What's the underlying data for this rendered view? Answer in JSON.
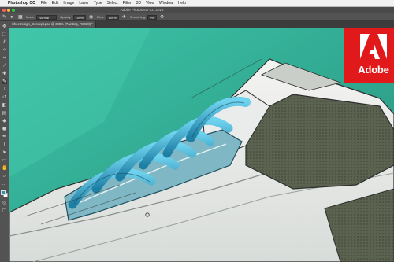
{
  "menubar": {
    "app_name": "Photoshop CC",
    "items": [
      "File",
      "Edit",
      "Image",
      "Layer",
      "Type",
      "Select",
      "Filter",
      "3D",
      "View",
      "Window",
      "Help"
    ]
  },
  "window": {
    "title": "Adobe Photoshop CC 2018"
  },
  "options": {
    "mode_label": "Mode:",
    "mode_value": "Normal",
    "opacity_label": "Opacity:",
    "opacity_value": "100%",
    "flow_label": "Flow:",
    "flow_value": "100%",
    "smoothing_label": "Smoothing:",
    "smoothing_value": "0%"
  },
  "document": {
    "tab_title": "ShoeDesign_Concept.psd @ 300% (Painting, RGB/8) *"
  },
  "brand": {
    "wordmark": "Adobe",
    "color": "#e2191b"
  },
  "colors": {
    "foreground": "#2f93b3",
    "background": "#ffffff"
  },
  "tools": [
    "move-icon",
    "marquee-icon",
    "lasso-icon",
    "quick-select-icon",
    "crop-icon",
    "eyedropper-icon",
    "healing-icon",
    "brush-icon",
    "clone-stamp-icon",
    "history-brush-icon",
    "eraser-icon",
    "gradient-icon",
    "blur-icon",
    "dodge-icon",
    "pen-icon",
    "type-icon",
    "path-select-icon",
    "shape-icon",
    "hand-icon",
    "zoom-icon"
  ]
}
